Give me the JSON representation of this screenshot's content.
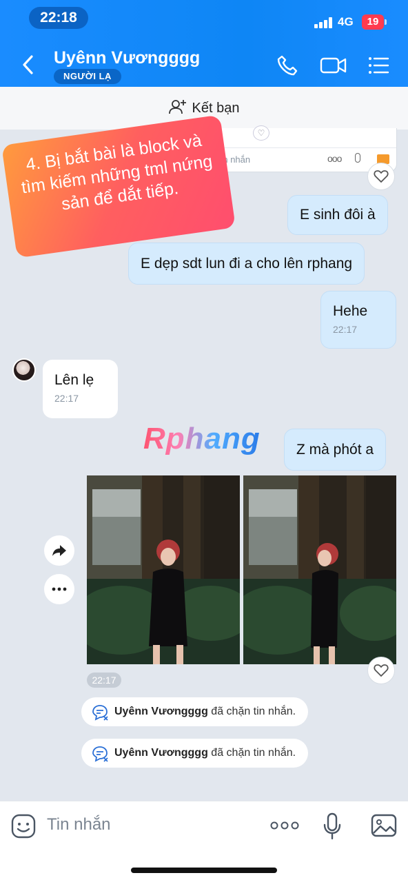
{
  "status": {
    "time": "22:18",
    "network": "4G",
    "battery": "19"
  },
  "header": {
    "title": "Uyênn Vươngggg",
    "badge": "NGƯỜI LẠ",
    "icons": [
      "chevron-left-icon",
      "phone-icon",
      "video-icon",
      "menu-icon"
    ]
  },
  "friend_bar": {
    "label": "Kết bạn",
    "icon": "add-friend-icon"
  },
  "quoted_preview": {
    "placeholder": "Tin nhắn"
  },
  "promo": {
    "text": "4. Bị bắt bài là block và tìm kiếm những tml nứng sản để dắt tiếp."
  },
  "watermark": {
    "text": "Rphang"
  },
  "messages": [
    {
      "from": "me",
      "text": "E sinh đôi à"
    },
    {
      "from": "me",
      "text": "E dẹp sdt lun đi a cho lên rphang"
    },
    {
      "from": "me",
      "text": "Hehe",
      "time": "22:17"
    },
    {
      "from": "them",
      "text": "Lên lẹ",
      "time": "22:17"
    },
    {
      "from": "me",
      "text": "Z mà phót a"
    }
  ],
  "photos": {
    "time": "22:17"
  },
  "notices": [
    {
      "name": "Uyênn Vươngggg",
      "text": "đã chặn tin nhắn."
    },
    {
      "name": "Uyênn Vươngggg",
      "text": "đã chặn tin nhắn."
    }
  ],
  "composer": {
    "placeholder": "Tin nhắn"
  },
  "colors": {
    "header": "#1a8cff",
    "my_bubble": "#d5ebfd",
    "background": "#e2e7ee"
  }
}
